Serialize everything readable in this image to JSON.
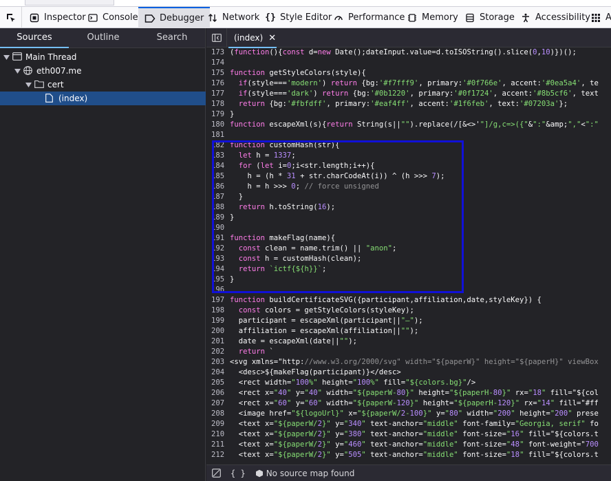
{
  "toolbar": {
    "tools": [
      {
        "label": "Inspector",
        "icon": "inspector-icon"
      },
      {
        "label": "Console",
        "icon": "console-icon"
      },
      {
        "label": "Debugger",
        "icon": "debugger-icon",
        "selected": true
      },
      {
        "label": "Network",
        "icon": "network-icon"
      },
      {
        "label": "Style Editor",
        "icon": "style-editor-icon"
      },
      {
        "label": "Performance",
        "icon": "performance-icon"
      },
      {
        "label": "Memory",
        "icon": "memory-icon"
      },
      {
        "label": "Storage",
        "icon": "storage-icon"
      },
      {
        "label": "Accessibility",
        "icon": "accessibility-icon"
      },
      {
        "label": "A",
        "icon": "application-icon"
      }
    ]
  },
  "sidebar": {
    "tabs": [
      "Sources",
      "Outline",
      "Search"
    ],
    "tree": [
      {
        "label": "Main Thread",
        "icon": "window-icon"
      },
      {
        "label": "eth007.me",
        "icon": "globe-icon"
      },
      {
        "label": "cert",
        "icon": "folder-icon"
      },
      {
        "label": "(index)",
        "icon": "file-icon",
        "selected": true
      }
    ]
  },
  "editor": {
    "tab_label": "(index)",
    "close_glyph": "✕",
    "lines": [
      {
        "num": "173",
        "text": "(function(){const d=new Date();dateInput.value=d.toISOString().slice(0,10)})();"
      },
      {
        "num": "174",
        "text": ""
      },
      {
        "num": "175",
        "text": "function getStyleColors(style){"
      },
      {
        "num": "176",
        "text": "  if(style==='modern') return {bg:'#f7fff9', primary:'#0f766e', accent:'#0ea5a4', te"
      },
      {
        "num": "177",
        "text": "  if(style==='dark') return {bg:'#0b1220', primary:'#0f1724', accent:'#8b5cf6', text"
      },
      {
        "num": "178",
        "text": "  return {bg:'#fbfdff', primary:'#eaf4ff', accent:'#1f6feb', text:'#07203a'};"
      },
      {
        "num": "179",
        "text": "}"
      },
      {
        "num": "180",
        "text": "function escapeXml(s){return String(s||\"\").replace(/[&<>'\"]/g,c=>({\"&\":\"&amp;\",\"<\":\""
      },
      {
        "num": "181",
        "text": ""
      },
      {
        "num": "182",
        "text": "function customHash(str){"
      },
      {
        "num": "183",
        "text": "  let h = 1337;"
      },
      {
        "num": "184",
        "text": "  for (let i=0;i<str.length;i++){"
      },
      {
        "num": "185",
        "text": "    h = (h * 31 + str.charCodeAt(i)) ^ (h >>> 7);"
      },
      {
        "num": "186",
        "text": "    h = h >>> 0; // force unsigned"
      },
      {
        "num": "187",
        "text": "  }"
      },
      {
        "num": "188",
        "text": "  return h.toString(16);"
      },
      {
        "num": "189",
        "text": "}"
      },
      {
        "num": "190",
        "text": ""
      },
      {
        "num": "191",
        "text": "function makeFlag(name){"
      },
      {
        "num": "192",
        "text": "  const clean = name.trim() || \"anon\";"
      },
      {
        "num": "193",
        "text": "  const h = customHash(clean);"
      },
      {
        "num": "194",
        "text": "  return `ictf{${h}}`;"
      },
      {
        "num": "195",
        "text": "}"
      },
      {
        "num": "196",
        "text": ""
      },
      {
        "num": "197",
        "text": "function buildCertificateSVG({participant,affiliation,date,styleKey}) {"
      },
      {
        "num": "198",
        "text": "  const colors = getStyleColors(styleKey);"
      },
      {
        "num": "199",
        "text": "  participant = escapeXml(participant||\"—\");"
      },
      {
        "num": "200",
        "text": "  affiliation = escapeXml(affiliation||\"\");"
      },
      {
        "num": "201",
        "text": "  date = escapeXml(date||\"\");"
      },
      {
        "num": "202",
        "text": "  return `"
      },
      {
        "num": "203",
        "text": "<svg xmlns=\"http://www.w3.org/2000/svg\" width=\"${paperW}\" height=\"${paperH}\" viewBox"
      },
      {
        "num": "204",
        "text": "  <desc>${makeFlag(participant)}</desc>"
      },
      {
        "num": "205",
        "text": "  <rect width=\"100%\" height=\"100%\" fill=\"${colors.bg}\"/>"
      },
      {
        "num": "206",
        "text": "  <rect x=\"40\" y=\"40\" width=\"${paperW-80}\" height=\"${paperH-80}\" rx=\"18\" fill=\"${col"
      },
      {
        "num": "207",
        "text": "  <rect x=\"60\" y=\"60\" width=\"${paperW-120}\" height=\"${paperH-120}\" rx=\"14\" fill=\"#ff"
      },
      {
        "num": "208",
        "text": "  <image href=\"${logoUrl}\" x=\"${paperW/2-100}\" y=\"80\" width=\"200\" height=\"200\" prese"
      },
      {
        "num": "209",
        "text": "  <text x=\"${paperW/2}\" y=\"340\" text-anchor=\"middle\" font-family=\"Georgia, serif\" fo"
      },
      {
        "num": "210",
        "text": "  <text x=\"${paperW/2}\" y=\"380\" text-anchor=\"middle\" font-size=\"16\" fill=\"${colors.t"
      },
      {
        "num": "211",
        "text": "  <text x=\"${paperW/2}\" y=\"460\" text-anchor=\"middle\" font-size=\"48\" font-weight=\"700"
      },
      {
        "num": "212",
        "text": "  <text x=\"${paperW/2}\" y=\"505\" text-anchor=\"middle\" font-size=\"18\" fill=\"${colors.t"
      }
    ]
  },
  "statusbar": {
    "pretty_print": "{ }",
    "source_map": "No source map found"
  },
  "colors": {
    "highlight_box": "#1010d8",
    "selected_row": "#204e8a",
    "accent": "#75bfff"
  }
}
